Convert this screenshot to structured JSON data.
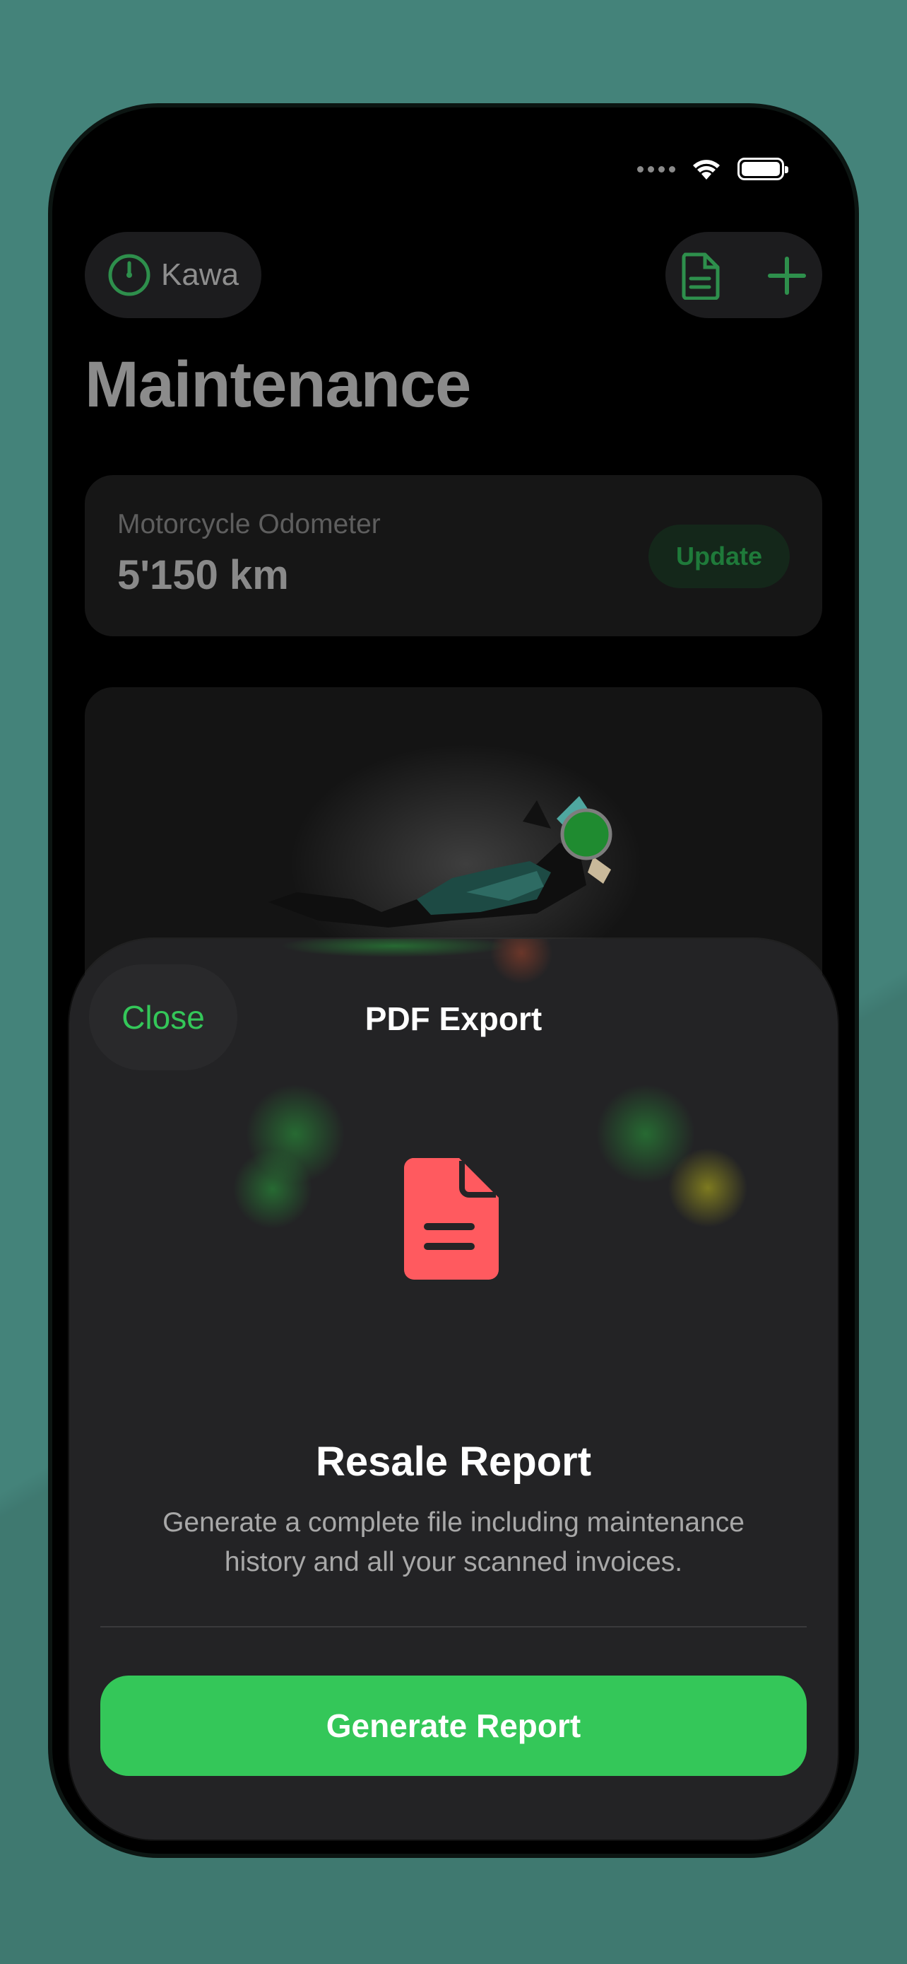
{
  "header": {
    "bike_name": "Kawa",
    "page_title": "Maintenance"
  },
  "odometer": {
    "label": "Motorcycle Odometer",
    "value": "5'150 km",
    "update_label": "Update"
  },
  "sheet": {
    "close_label": "Close",
    "title": "PDF Export",
    "report_title": "Resale Report",
    "report_description": "Generate a complete file including maintenance history and all your scanned invoices.",
    "generate_label": "Generate Report"
  },
  "colors": {
    "accent": "#34c759",
    "pdf_icon": "#ff5a5f",
    "background": "#44837a"
  },
  "icons": {
    "gauge": "speedometer-icon",
    "document": "document-icon",
    "add": "plus-icon",
    "pdf": "pdf-document-icon"
  }
}
